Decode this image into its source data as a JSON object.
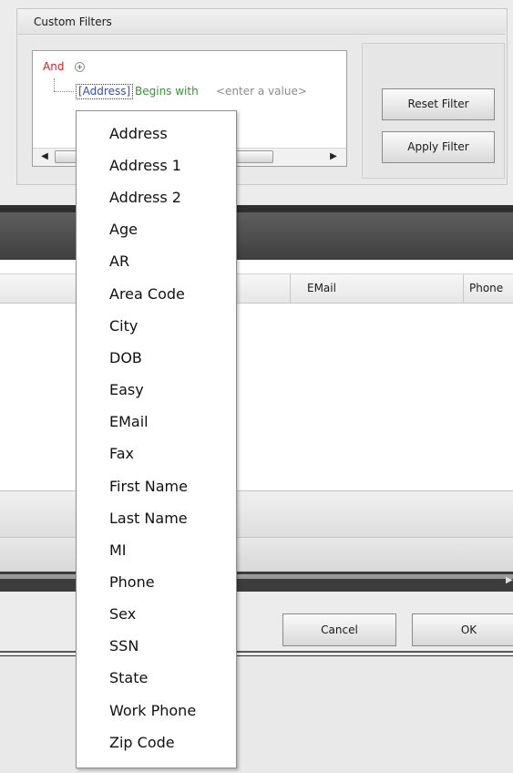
{
  "filters": {
    "title": "Custom Filters",
    "group_operator": "And",
    "condition": {
      "field": "[Address]",
      "operator": "Begins with",
      "value_placeholder": "<enter a value>"
    },
    "buttons": {
      "reset": "Reset Filter",
      "apply": "Apply Filter"
    }
  },
  "grid": {
    "columns": [
      "EMail",
      "Phone"
    ]
  },
  "dialog": {
    "cancel": "Cancel",
    "ok": "OK"
  },
  "field_dropdown": {
    "items": [
      "Address",
      "Address 1",
      "Address 2",
      "Age",
      "AR",
      "Area Code",
      "City",
      "DOB",
      "Easy",
      "EMail",
      "Fax",
      "First Name",
      "Last Name",
      "MI",
      "Phone",
      "Sex",
      "SSN",
      "State",
      "Work Phone",
      "Zip Code"
    ]
  },
  "colors": {
    "group_operator": "#cc1f1f",
    "field": "#2a4fbf",
    "operator": "#2e9a2e",
    "placeholder": "#8c8c8c"
  },
  "icons": [
    "add-condition-icon",
    "scroll-left-icon",
    "scroll-right-icon",
    "expand-arrow-icon"
  ]
}
